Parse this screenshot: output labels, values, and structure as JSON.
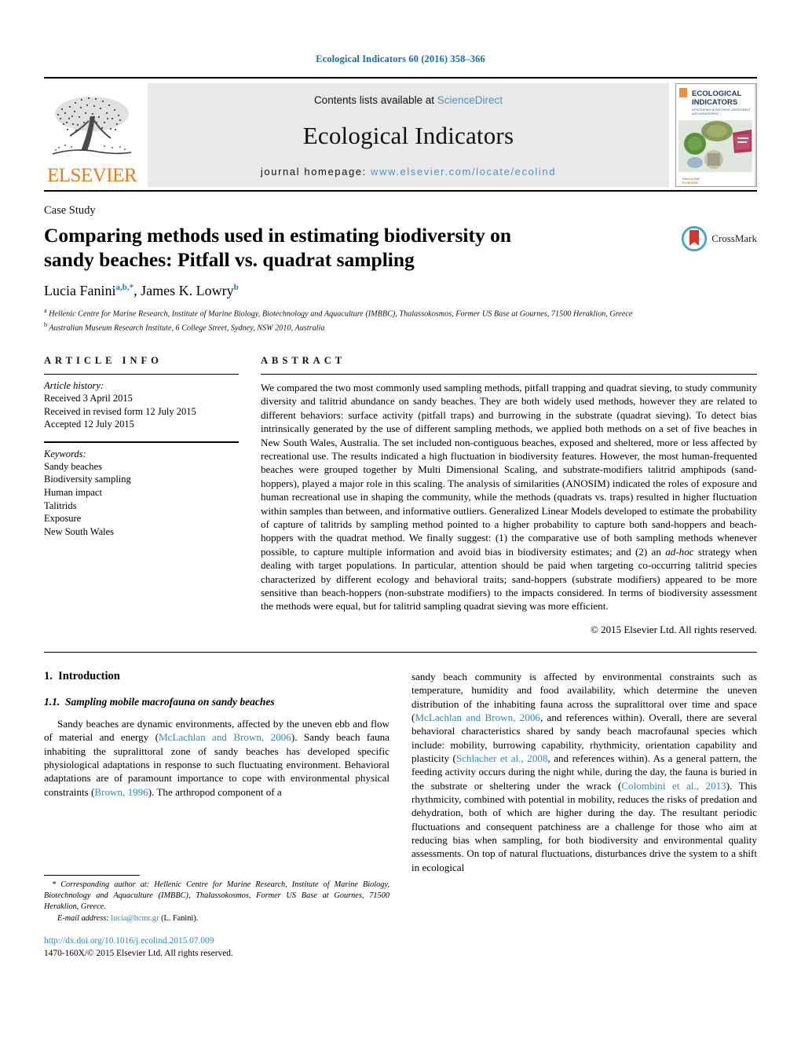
{
  "running_head": "Ecological Indicators 60 (2016) 358–366",
  "masthead": {
    "publisher": "ELSEVIER",
    "contents_prefix": "Contents lists available at ",
    "contents_link": "ScienceDirect",
    "journal_title": "Ecological Indicators",
    "homepage_prefix": "journal homepage: ",
    "homepage_url": "www.elsevier.com/locate/ecolind",
    "cover_title_line1": "ECOLOGICAL",
    "cover_title_line2": "INDICATORS"
  },
  "article": {
    "type": "Case Study",
    "title": "Comparing methods used in estimating biodiversity on sandy beaches: Pitfall vs. quadrat sampling",
    "crossmark_label": "CrossMark",
    "authors_html": "Lucia Fanini<sup>a,b,*</sup>, James K. Lowry<sup>b</sup>",
    "affiliation_a": "Hellenic Centre for Marine Research, Institute of Marine Biology, Biotechnology and Aquaculture (IMBBC), Thalassokosmos, Former US Base at Gournes, 71500 Heraklion, Greece",
    "affiliation_b": "Australian Museum Research Institute, 6 College Street, Sydney, NSW 2010, Australia"
  },
  "article_info": {
    "heading": "ARTICLE INFO",
    "history_title": "Article history:",
    "history": [
      "Received 3 April 2015",
      "Received in revised form 12 July 2015",
      "Accepted 12 July 2015"
    ],
    "keywords_title": "Keywords:",
    "keywords": [
      "Sandy beaches",
      "Biodiversity sampling",
      "Human impact",
      "Talitrids",
      "Exposure",
      "New South Wales"
    ]
  },
  "abstract": {
    "heading": "ABSTRACT",
    "text": "We compared the two most commonly used sampling methods, pitfall trapping and quadrat sieving, to study community diversity and talitrid abundance on sandy beaches. They are both widely used methods, however they are related to different behaviors: surface activity (pitfall traps) and burrowing in the substrate (quadrat sieving). To detect bias intrinsically generated by the use of different sampling methods, we applied both methods on a set of five beaches in New South Wales, Australia. The set included non-contiguous beaches, exposed and sheltered, more or less affected by recreational use. The results indicated a high fluctuation in biodiversity features. However, the most human-frequented beaches were grouped together by Multi Dimensional Scaling, and substrate-modifiers talitrid amphipods (sand-hoppers), played a major role in this scaling. The analysis of similarities (ANOSIM) indicated the roles of exposure and human recreational use in shaping the community, while the methods (quadrats vs. traps) resulted in higher fluctuation within samples than between, and informative outliers. Generalized Linear Models developed to estimate the probability of capture of talitrids by sampling method pointed to a higher probability to capture both sand-hoppers and beach-hoppers with the quadrat method. We finally suggest: (1) the comparative use of both sampling methods whenever possible, to capture multiple information and avoid bias in biodiversity estimates; and (2) an ",
    "text_italic": "ad-hoc",
    "text_after": " strategy when dealing with target populations. In particular, attention should be paid when targeting co-occurring talitrid species characterized by different ecology and behavioral traits; sand-hoppers (substrate modifiers) appeared to be more sensitive than beach-hoppers (non-substrate modifiers) to the impacts considered. In terms of biodiversity assessment the methods were equal, but for talitrid sampling quadrat sieving was more efficient.",
    "copyright": "© 2015 Elsevier Ltd. All rights reserved."
  },
  "body": {
    "section_number": "1.",
    "section_title": "Introduction",
    "subsection_number": "1.1.",
    "subsection_title": "Sampling mobile macrofauna on sandy beaches",
    "left_para_1a": "Sandy beaches are dynamic environments, affected by the uneven ebb and flow of material and energy (",
    "left_ref_1": "McLachlan and Brown, 2006",
    "left_para_1b": "). Sandy beach fauna inhabiting the supralittoral zone of sandy beaches has developed specific physiological adaptations in response to such fluctuating environment. Behavioral adaptations are of paramount importance to cope with environmental physical constraints (",
    "left_ref_2": "Brown, 1996",
    "left_para_1c": "). The arthropod component of a",
    "right_para_1a": "sandy beach community is affected by environmental constraints such as temperature, humidity and food availability, which determine the uneven distribution of the inhabiting fauna across the supralittoral over time and space (",
    "right_ref_1": "McLachlan and Brown, 2006",
    "right_para_1b": ", and references within). Overall, there are several behavioral characteristics shared by sandy beach macrofaunal species which include: mobility, burrowing capability, rhythmicity, orientation capability and plasticity (",
    "right_ref_2": "Schlacher et al., 2008",
    "right_para_1c": ", and references within). As a general pattern, the feeding activity occurs during the night while, during the day, the fauna is buried in the substrate or sheltering under the wrack (",
    "right_ref_3": "Colombini et al., 2013",
    "right_para_1d": "). This rhythmicity, combined with potential in mobility, reduces the risks of predation and dehydration, both of which are higher during the day. The resultant periodic fluctuations and consequent patchiness are a challenge for those who aim at reducing bias when sampling, for both biodiversity and environmental quality assessments. On top of natural fluctuations, disturbances drive the system to a shift in ecological"
  },
  "footnote": {
    "corresponding": "* Corresponding author at: Hellenic Centre for Marine Research, Institute of Marine Biology, Biotechnology and Aquaculture (IMBBC), Thalassokosmos, Former US Base at Gournes, 71500 Heraklion, Greece.",
    "email_label": "E-mail address:",
    "email": "lucia@hcmr.gr",
    "email_suffix": " (L. Fanini).",
    "doi": "http://dx.doi.org/10.1016/j.ecolind.2015.07.009",
    "issn_line": "1470-160X/© 2015 Elsevier Ltd. All rights reserved."
  },
  "colors": {
    "link_blue": "#2a8cbf",
    "runhead_blue": "#1a6fa3",
    "elsevier_orange": "#e87d1e",
    "band_gray": "#e9e9e9"
  }
}
